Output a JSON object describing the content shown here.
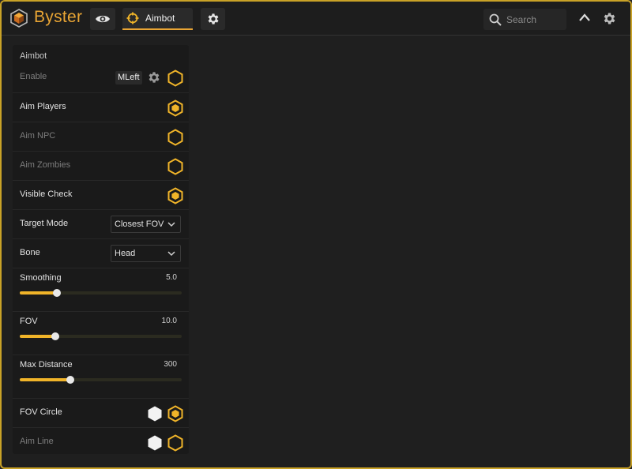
{
  "app": {
    "name": "Byster"
  },
  "colors": {
    "accent": "#f0b429",
    "border": "#c9a227",
    "bg": "#1f1f1f",
    "panel": "#1a1a1a"
  },
  "titlebar": {
    "tabs": [
      {
        "icon": "eye-icon"
      },
      {
        "icon": "crosshair-icon",
        "label": "Aimbot",
        "active": true
      },
      {
        "icon": "gear-icon"
      }
    ],
    "search": {
      "placeholder": "Search",
      "value": ""
    }
  },
  "panel": {
    "title": "Aimbot",
    "enable": {
      "label": "Enable",
      "key": "MLeft",
      "enabled": false
    },
    "aim_players": {
      "label": "Aim Players",
      "enabled": true
    },
    "aim_npc": {
      "label": "Aim NPC",
      "enabled": false
    },
    "aim_zombies": {
      "label": "Aim Zombies",
      "enabled": false
    },
    "visible_check": {
      "label": "Visible Check",
      "enabled": true
    },
    "target_mode": {
      "label": "Target Mode",
      "value": "Closest FOV"
    },
    "bone": {
      "label": "Bone",
      "value": "Head"
    },
    "smoothing": {
      "label": "Smoothing",
      "value": "5.0",
      "fraction": 0.23
    },
    "fov": {
      "label": "FOV",
      "value": "10.0",
      "fraction": 0.22
    },
    "max_distance": {
      "label": "Max Distance",
      "value": "300",
      "fraction": 0.31
    },
    "fov_circle": {
      "label": "FOV Circle",
      "color": "#f2f2f2",
      "enabled": true
    },
    "aim_line": {
      "label": "Aim Line",
      "color": "#f2f2f2",
      "enabled": false
    }
  }
}
